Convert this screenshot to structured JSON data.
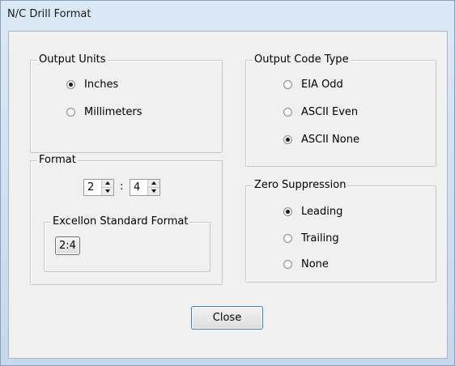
{
  "window": {
    "title": "N/C Drill Format"
  },
  "output_units": {
    "legend": "Output Units",
    "options": [
      {
        "label": "Inches",
        "checked": true
      },
      {
        "label": "Millimeters",
        "checked": false
      }
    ]
  },
  "format": {
    "legend": "Format",
    "integer_digits": "2",
    "separator": ":",
    "decimal_digits": "4",
    "excellon": {
      "legend": "Excellon Standard Format",
      "button_label": "2:4"
    }
  },
  "output_code_type": {
    "legend": "Output Code Type",
    "options": [
      {
        "label": "EIA Odd",
        "checked": false
      },
      {
        "label": "ASCII Even",
        "checked": false
      },
      {
        "label": "ASCII None",
        "checked": true
      }
    ]
  },
  "zero_suppression": {
    "legend": "Zero Suppression",
    "options": [
      {
        "label": "Leading",
        "checked": true
      },
      {
        "label": "Trailing",
        "checked": false
      },
      {
        "label": "None",
        "checked": false
      }
    ]
  },
  "close_button": {
    "label": "Close"
  }
}
